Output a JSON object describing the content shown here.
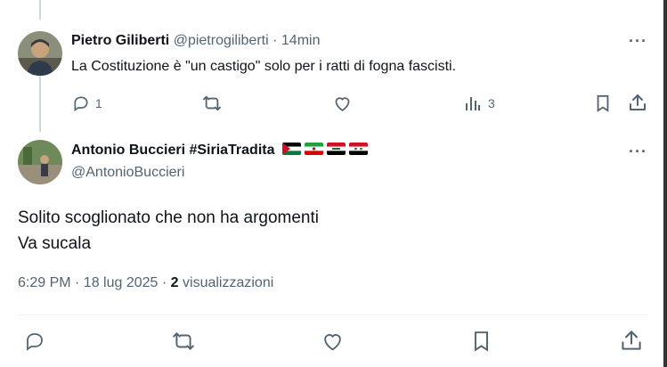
{
  "reply_tweet": {
    "author_name": "Pietro Giliberti",
    "handle": "@pietrogiliberti",
    "separator": "·",
    "time": "14min",
    "text": "La Costituzione è \"un castigo\" solo per i ratti di fogna fascisti.",
    "reply_count": "1",
    "views_count": "3",
    "more_label": "···"
  },
  "main_tweet": {
    "author_name": "Antonio Buccieri #SiriaTradita",
    "handle": "@AntonioBuccieri",
    "flags": [
      "palestine-flag",
      "iran-flag",
      "iraq-flag",
      "syria-flag"
    ],
    "text_line1": "Solito scoglionato che non ha argomenti",
    "text_line2": "Va sucala",
    "timestamp": "6:29 PM · 18 lug 2025 · ",
    "views_count": "2",
    "views_label": " visualizzazioni",
    "more_label": "···"
  },
  "colors": {
    "muted": "#536471",
    "divider": "#eff3f4",
    "thread_line": "#cfd9de"
  }
}
